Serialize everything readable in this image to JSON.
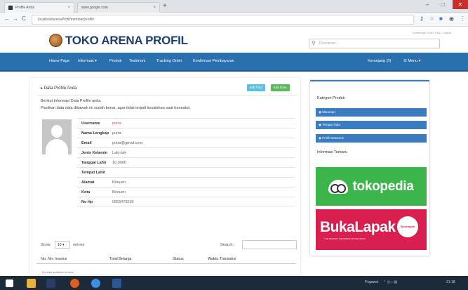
{
  "browser": {
    "tabs": [
      {
        "label": "Profile Anda"
      },
      {
        "label": "www.google.com"
      }
    ],
    "new_tab": "+",
    "window_controls": {
      "minimize": "–",
      "maximize": "□",
      "close": "✕"
    },
    "nav": {
      "back": "←",
      "forward": "→",
      "reload": "C"
    },
    "url": "localhost/arenaProfil/member/profile"
  },
  "header": {
    "logo_text": "TOKO ARENA PROFIL",
    "top_links": "Konfirmasi Order   Trick – Daftar",
    "search_placeholder": "Pencarian..."
  },
  "navbar": {
    "items": [
      {
        "label": "Home Page"
      },
      {
        "label": "Informasi ▾"
      },
      {
        "label": "Produk"
      },
      {
        "label": "Testimoni"
      },
      {
        "label": "Tracking Order"
      },
      {
        "label": "Konfirmasi Pembayaran"
      }
    ],
    "cart": "Keranjang (0)",
    "menu": "☰ Menu ▾"
  },
  "profile": {
    "title": "Data Profile Anda",
    "edit_button": "Edit Foto",
    "edit_data_button": "Edit Data",
    "info_line1": "Berikut Informasi Data Profile anda.",
    "info_line2": "Pastikan data data dibawah ini sudah benar, agar tidak terjadi kesalahan saat transaksi.",
    "fields": [
      {
        "key": "Username",
        "value": "putra"
      },
      {
        "key": "Nama Lengkap",
        "value": "putra"
      },
      {
        "key": "Email",
        "value": "putra@gmail.com"
      },
      {
        "key": "Jenis Kelamin",
        "value": "Laki-laki"
      },
      {
        "key": "Tanggal Lahir",
        "value": "10 0000"
      },
      {
        "key": "Tempat Lahir",
        "value": ""
      },
      {
        "key": "Alamat",
        "value": "Bireuen"
      },
      {
        "key": "Kota",
        "value": "Bireuen"
      },
      {
        "key": "No Hp",
        "value": "0853476599"
      }
    ]
  },
  "table": {
    "show_label": "Show",
    "show_value": "10",
    "entries_label": "entries",
    "search_label": "Search:",
    "columns": [
      "No.",
      "No. Invoice",
      "Total Belanja",
      "Status",
      "Waktu Transaksi"
    ],
    "empty": "No data available in table"
  },
  "sidebar": {
    "category_title": "Kategori Produk",
    "items": [
      {
        "label": "Minuman"
      },
      {
        "label": "Tempat Tidur"
      },
      {
        "label": "Profil Aksesoris"
      }
    ],
    "info_title": "Informasi Terbaru",
    "tokopedia": "tokopedia",
    "bukalapak": "BukaLapak",
    "bukalapak_tagline": "THE BIGGEST INDONESIA ONLINE SHOP",
    "bukalapak_badge": "Bukalapak"
  },
  "taskbar": {
    "tray_text": "Pegawai",
    "clock": "21:18"
  }
}
